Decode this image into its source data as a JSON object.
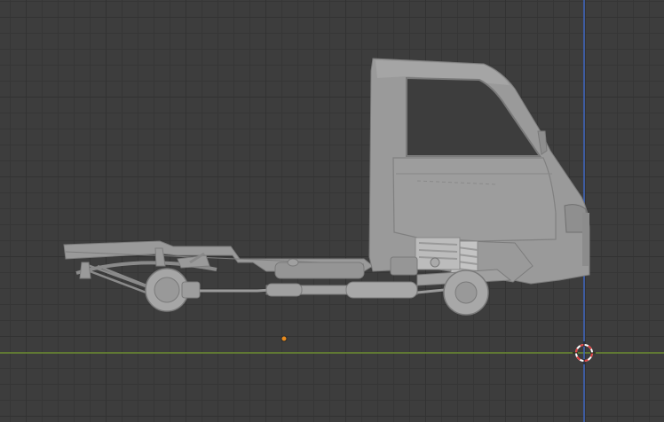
{
  "viewport": {
    "background_color": "#3d3d3d",
    "grid_minor_color": "#363636",
    "grid_major_color": "#323232",
    "x_axis_color": "#6e8f32",
    "z_axis_color": "#3e66c2",
    "model_color": "#9a9a9a",
    "model_shade_color": "#7c7c7c",
    "origin_dot_color": "#e88b1e",
    "cursor_colors": [
      "#e04040",
      "#ffffff"
    ],
    "view": "right-orthographic",
    "object": "mini-truck-chassis-cab-model"
  }
}
